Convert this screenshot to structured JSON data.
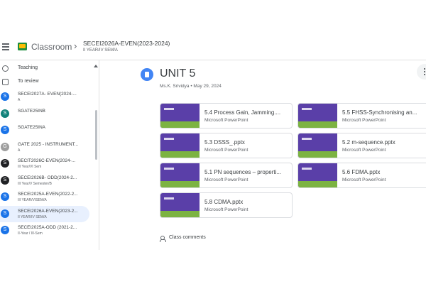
{
  "header": {
    "app_name": "Classroom",
    "course_title": "SECEI2026A-EVEN(2023-2024)",
    "course_subtitle": "II YEAR/IV SEM/A"
  },
  "sidebar": {
    "nav": [
      {
        "label": "Teaching",
        "icon": "people-icon"
      },
      {
        "label": "To review",
        "icon": "folder-icon"
      }
    ],
    "classes": [
      {
        "initial": "S",
        "color": "#1a73e8",
        "name": "SECEI2027A- EVEN(2024-...",
        "sub": "A"
      },
      {
        "initial": "S",
        "color": "#12827a",
        "name": "SGATE25INB",
        "sub": ""
      },
      {
        "initial": "S",
        "color": "#1a73e8",
        "name": "SGATE25INA",
        "sub": ""
      },
      {
        "initial": "G",
        "color": "#9e9e9e",
        "name": "GATE 2025 - INSTRUMENT...",
        "sub": "A"
      },
      {
        "initial": "S",
        "color": "#202124",
        "name": "SECIT2026C-EVEN(2024-...",
        "sub": "III Year/VI Sem"
      },
      {
        "initial": "S",
        "color": "#202124",
        "name": "SECEI2026B- ODD(2024-2...",
        "sub": "III Year/V Semester/B"
      },
      {
        "initial": "S",
        "color": "#1a73e8",
        "name": "SECEI2025A-EVEN(2022-2...",
        "sub": "III YEAR/VISEM/A"
      },
      {
        "initial": "S",
        "color": "#1a73e8",
        "name": "SECEI2026A-EVEN(2023-2...",
        "sub": "II YEAR/IV SEM/A",
        "active": true
      },
      {
        "initial": "S",
        "color": "#1a73e8",
        "name": "SECEI2025A-ODD (2021-2...",
        "sub": "II-Year / III-Sem"
      }
    ]
  },
  "material": {
    "title": "UNIT 5",
    "meta": "Ms.K. Srividya • May 29, 2024"
  },
  "attachments": [
    {
      "name": "5.4 Process Gain, Jamming....",
      "type": "Microsoft PowerPoint"
    },
    {
      "name": "5.5 FHSS-Synchronising an...",
      "type": "Microsoft PowerPoint"
    },
    {
      "name": "5.3 DSSS_.pptx",
      "type": "Microsoft PowerPoint"
    },
    {
      "name": "5.2 m-sequence.pptx",
      "type": "Microsoft PowerPoint"
    },
    {
      "name": "5.1 PN sequences – properti...",
      "type": "Microsoft PowerPoint"
    },
    {
      "name": "5.6 FDMA.pptx",
      "type": "Microsoft PowerPoint"
    },
    {
      "name": "5.8 CDMA.pptx",
      "type": "Microsoft PowerPoint"
    }
  ],
  "comments": {
    "label": "Class comments"
  }
}
